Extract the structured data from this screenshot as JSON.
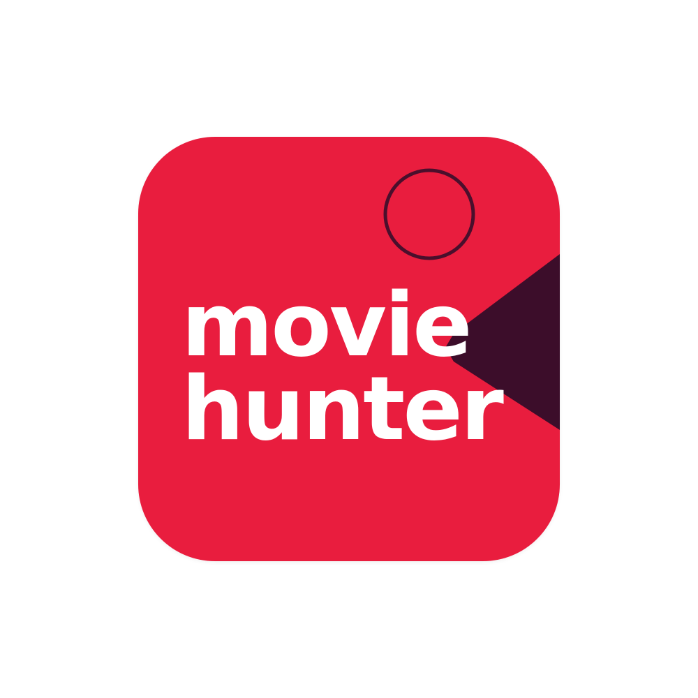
{
  "app_icon": {
    "icon_name": "movie-hunter-app-icon",
    "colors": {
      "background": "#E91D3E",
      "triangle": "#3C0D2A",
      "circle_outline": "#4A0F2C",
      "text": "#FFFFFF"
    },
    "wordmark": {
      "line1": "movie",
      "line2": "hunter"
    }
  }
}
